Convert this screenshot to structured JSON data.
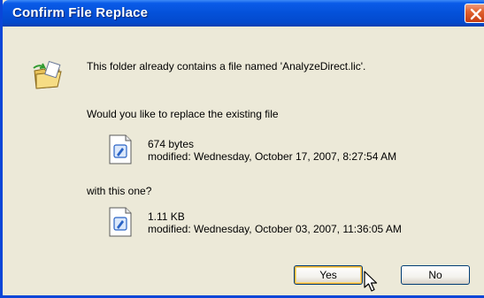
{
  "window": {
    "title": "Confirm File Replace"
  },
  "message": {
    "line": "This folder already contains a file named 'AnalyzeDirect.lic'.",
    "question": "Would you like to replace the existing file",
    "with": "with this one?"
  },
  "existing_file": {
    "size": "674 bytes",
    "modified": "modified: Wednesday, October 17, 2007, 8:27:54 AM"
  },
  "new_file": {
    "size": "1.11 KB",
    "modified": "modified: Wednesday, October 03, 2007, 11:36:05 AM"
  },
  "buttons": {
    "yes": "Yes",
    "no": "No"
  },
  "icons": {
    "title_close": "close-icon",
    "folder": "folder-replace-icon",
    "file": "document-icon",
    "cursor": "mouse-pointer-icon"
  },
  "colors": {
    "titlebar": "#0451d9",
    "close": "#e1622f",
    "dialog_bg": "#ece9d8",
    "default_button_focus": "#f8b331"
  }
}
